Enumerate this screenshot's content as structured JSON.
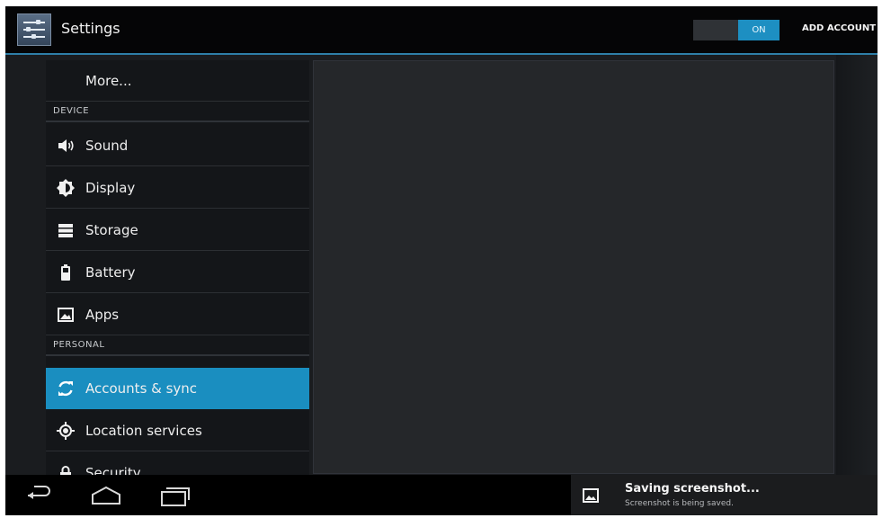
{
  "action_bar": {
    "title": "Settings",
    "toggle_label": "ON",
    "add_account": "ADD ACCOUNT"
  },
  "list": {
    "more": "More...",
    "device_header": "DEVICE",
    "sound": "Sound",
    "display": "Display",
    "storage": "Storage",
    "battery": "Battery",
    "apps": "Apps",
    "personal_header": "PERSONAL",
    "accounts": "Accounts & sync",
    "location": "Location services",
    "security": "Security"
  },
  "icons": {
    "app": "settings-sliders-icon",
    "sound": "speaker-icon",
    "display": "brightness-icon",
    "storage": "storage-icon",
    "battery": "battery-icon",
    "apps": "apps-icon",
    "accounts": "sync-icon",
    "location": "location-icon",
    "security": "lock-icon",
    "back": "back-icon",
    "home": "home-icon",
    "recents": "recents-icon",
    "screenshot": "image-icon"
  },
  "notification": {
    "title": "Saving screenshot...",
    "text": "Screenshot is being saved."
  },
  "colors": {
    "accent": "#1a8ec0",
    "action_bar": "#050506",
    "list_bg": "#141619",
    "detail_bg": "#25272a"
  }
}
